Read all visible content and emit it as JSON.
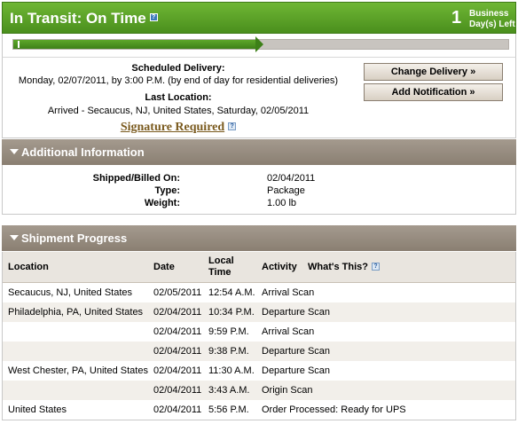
{
  "header": {
    "title": "In Transit: On Time",
    "days_number": "1",
    "days_label_line1": "Business",
    "days_label_line2": "Day(s) Left"
  },
  "progress": {
    "fraction": 0.49
  },
  "delivery": {
    "scheduled_label": "Scheduled Delivery:",
    "scheduled_value": "Monday, 02/07/2011, by 3:00 P.M. (by end of day for residential deliveries)",
    "last_location_label": "Last Location:",
    "last_location_value": "Arrived - Secaucus, NJ, United States, Saturday, 02/05/2011",
    "signature_link": "Signature Required",
    "change_delivery_button": "Change Delivery »",
    "add_notification_button": "Add Notification »"
  },
  "additional": {
    "title": "Additional Information",
    "fields": [
      {
        "label": "Shipped/Billed On:",
        "value": "02/04/2011"
      },
      {
        "label": "Type:",
        "value": "Package"
      },
      {
        "label": "Weight:",
        "value": "1.00 lb"
      }
    ]
  },
  "progress_table": {
    "title": "Shipment Progress",
    "headers": {
      "location": "Location",
      "date": "Date",
      "local_time_line1": "Local",
      "local_time_line2": "Time",
      "activity": "Activity",
      "whats_this": "What's This?"
    },
    "rows": [
      {
        "location": "Secaucus, NJ, United States",
        "date": "02/05/2011",
        "time": "12:54 A.M.",
        "activity": "Arrival Scan"
      },
      {
        "location": "Philadelphia, PA, United States",
        "date": "02/04/2011",
        "time": "10:34 P.M.",
        "activity": "Departure Scan"
      },
      {
        "location": "",
        "date": "02/04/2011",
        "time": "9:59 P.M.",
        "activity": "Arrival Scan"
      },
      {
        "location": "",
        "date": "02/04/2011",
        "time": "9:38 P.M.",
        "activity": "Departure Scan"
      },
      {
        "location": "West Chester, PA, United States",
        "date": "02/04/2011",
        "time": "11:30 A.M.",
        "activity": "Departure Scan"
      },
      {
        "location": "",
        "date": "02/04/2011",
        "time": "3:43 A.M.",
        "activity": "Origin Scan"
      },
      {
        "location": "United States",
        "date": "02/04/2011",
        "time": "5:56 P.M.",
        "activity": "Order Processed: Ready for UPS"
      }
    ]
  },
  "icons": {
    "help": "help-icon",
    "collapse": "triangle-down-icon"
  },
  "colors": {
    "header_green": "#4a8f1d",
    "section_taupe": "#8a7f72",
    "signature_brown": "#7a5a1e"
  }
}
